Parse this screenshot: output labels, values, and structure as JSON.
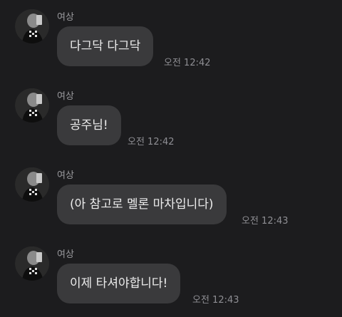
{
  "messages": [
    {
      "sender": "여상",
      "text": "다그닥 다그닥",
      "time": "오전 12:42"
    },
    {
      "sender": "여상",
      "text": "공주님!",
      "time": "오전 12:42"
    },
    {
      "sender": "여상",
      "text": "(아 참고로 멜론 마차입니다)",
      "time": "오전 12:43"
    },
    {
      "sender": "여상",
      "text": "이제 타셔야합니다!",
      "time": "오전 12:43"
    }
  ]
}
